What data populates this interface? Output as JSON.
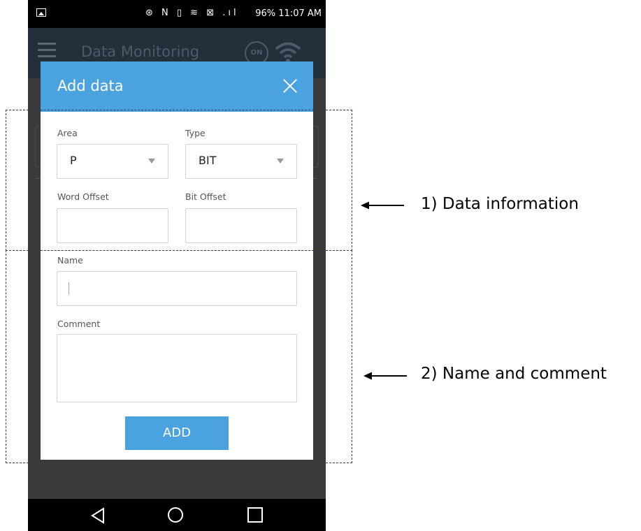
{
  "status_bar": {
    "icons_text": "⊛ N ▯ ≋ ⊠ .ıl",
    "battery": "96%",
    "time": "11:07 AM"
  },
  "app_bar": {
    "title": "Data Monitoring",
    "toggle_label": "ON"
  },
  "dialog": {
    "title": "Add data",
    "area": {
      "label": "Area",
      "value": "P"
    },
    "type": {
      "label": "Type",
      "value": "BIT"
    },
    "word_offset": {
      "label": "Word Offset",
      "value": ""
    },
    "bit_offset": {
      "label": "Bit Offset",
      "value": ""
    },
    "name": {
      "label": "Name",
      "value": ""
    },
    "comment": {
      "label": "Comment",
      "value": ""
    },
    "add_button": "ADD"
  },
  "annotations": {
    "data_information": "1) Data information",
    "name_and_comment": "2) Name and comment"
  },
  "colors": {
    "accent": "#4aa3df",
    "app_bar": "#242f3c",
    "dim_background": "#3a3a3a",
    "annotation_border": "#2f3d57"
  }
}
